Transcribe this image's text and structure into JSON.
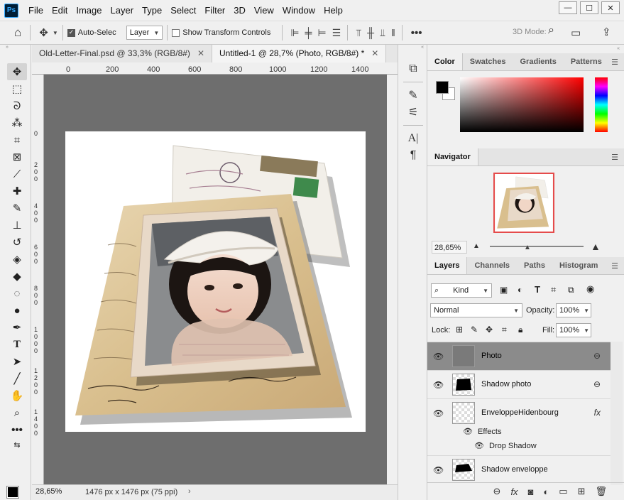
{
  "app": {
    "logo": "Ps",
    "menu": [
      "File",
      "Edit",
      "Image",
      "Layer",
      "Type",
      "Select",
      "Filter",
      "3D",
      "View",
      "Window",
      "Help"
    ],
    "window_controls": [
      "—",
      "☐",
      "✕"
    ]
  },
  "options_bar": {
    "auto_select_label": "Auto-Select:",
    "auto_select_checked": true,
    "target_value": "Layer",
    "show_transform_label": "Show Transform Controls",
    "show_transform_checked": false,
    "three_d_label": "3D Mode:",
    "more": "•••"
  },
  "document": {
    "tabs": [
      {
        "label": "Old-Letter-Final.psd @ 33,3% (RGB/8#)",
        "active": false
      },
      {
        "label": "Untitled-1 @ 28,7% (Photo, RGB/8#) *",
        "active": true
      }
    ],
    "ruler_top": [
      "0",
      "200",
      "400",
      "600",
      "800",
      "1000",
      "1200",
      "1400"
    ],
    "ruler_left": [
      "0",
      "2",
      "0",
      "0",
      "4",
      "0",
      "0",
      "6",
      "0",
      "0",
      "8",
      "0",
      "0",
      "1",
      "0",
      "0",
      "0",
      "1",
      "2",
      "0",
      "0",
      "1",
      "4",
      "0",
      "0"
    ],
    "zoom": "28,65%",
    "info": "1476 px x 1476 px (75 ppi)",
    "status_arrow": "›"
  },
  "colors": {
    "workspace_bg": "#6e6e6e",
    "selected_layer_bg": "#8b8b8b",
    "nav_frame": "#e54b4b",
    "paper_light": "#e9d7b3",
    "paper_dark": "#c9a977",
    "postcard": "#f2efe9",
    "photo_frame": "#e8d9c8"
  },
  "panels": {
    "color_tabs": [
      "Color",
      "Swatches",
      "Gradients",
      "Patterns"
    ],
    "navigator_title": "Navigator",
    "navigator_zoom": "28,65%",
    "layers_tabs": [
      "Layers",
      "Channels",
      "Paths",
      "Histogram"
    ],
    "filter_kind": "Kind",
    "blend_mode": "Normal",
    "opacity_label": "Opacity:",
    "opacity_value": "100%",
    "lock_label": "Lock:",
    "fill_label": "Fill:",
    "fill_value": "100%",
    "layers": [
      {
        "name": "Photo",
        "selected": true,
        "link": true
      },
      {
        "name": "Shadow photo",
        "selected": false,
        "link": true
      },
      {
        "name": "EnveloppeHidenbourg",
        "selected": false,
        "fx": "fx"
      },
      {
        "name": "Shadow enveloppe",
        "selected": false
      }
    ],
    "effects_label": "Effects",
    "drop_shadow_label": "Drop Shadow"
  }
}
